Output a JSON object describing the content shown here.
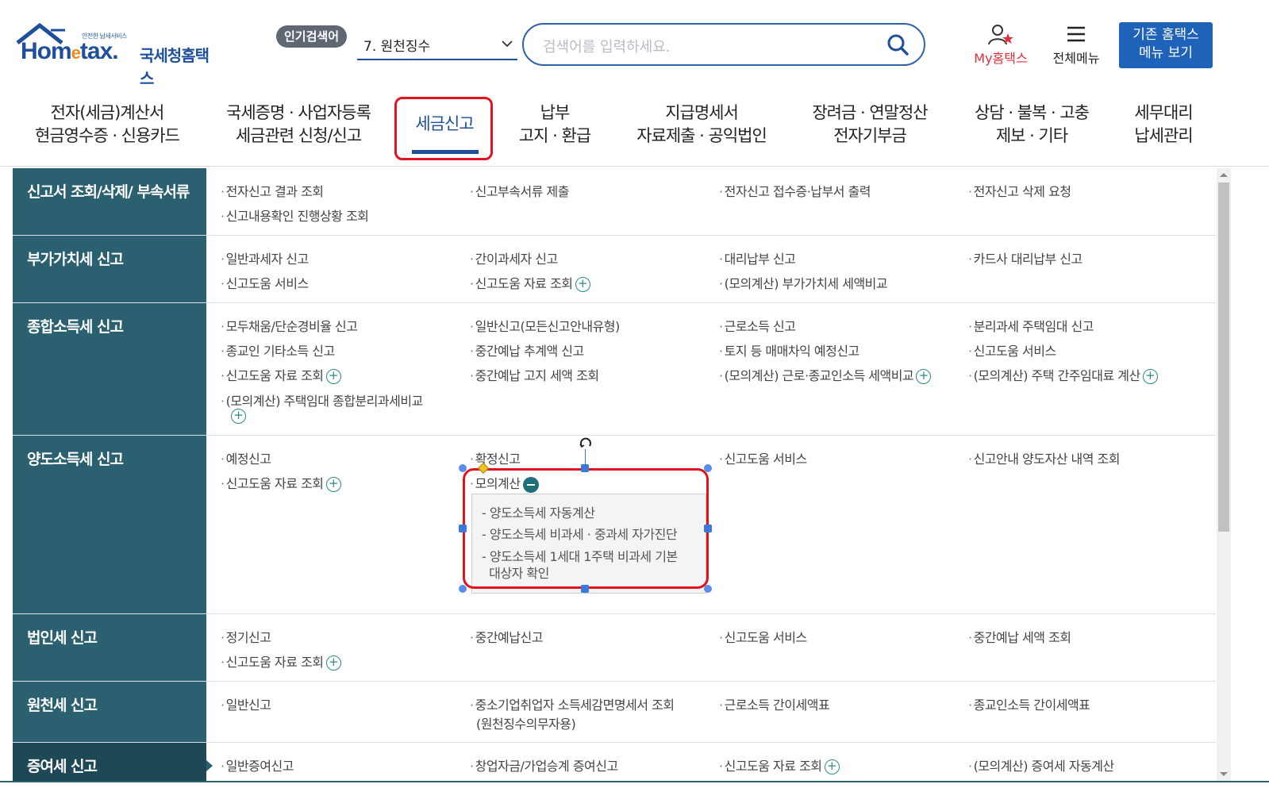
{
  "header": {
    "logo": {
      "sub": "안전한 납세서비스",
      "brand_a": "Hom",
      "brand_e": "e",
      "brand_b": "tax.",
      "kor": "국세청홈택스"
    },
    "popular_badge": "인기검색어",
    "popular_value": "7.  원천징수",
    "search_placeholder": "검색어를 입력하세요.",
    "mytax_label": "My홈택스",
    "allmenu_label": "전체메뉴",
    "old_btn_line1": "기존 홈택스",
    "old_btn_line2": "메뉴 보기"
  },
  "nav": [
    {
      "line1": "전자(세금)계산서",
      "line2": "현금영수증 · 신용카드"
    },
    {
      "line1": "국세증명 · 사업자등록",
      "line2": "세금관련 신청/신고"
    },
    {
      "line1": "세금신고",
      "line2": ""
    },
    {
      "line1": "납부",
      "line2": "고지 · 환급"
    },
    {
      "line1": "지급명세서",
      "line2": "자료제출 · 공익법인"
    },
    {
      "line1": "장려금 · 연말정산",
      "line2": "전자기부금"
    },
    {
      "line1": "상담 · 불복 · 고충",
      "line2": "제보 · 기타"
    },
    {
      "line1": "세무대리",
      "line2": "납세관리"
    }
  ],
  "rows": [
    {
      "cat": "신고서 조회/삭제/ 부속서류",
      "links": [
        "전자신고 결과 조회",
        "신고부속서류 제출",
        "전자신고 접수증·납부서 출력",
        "전자신고 삭제 요청",
        "신고내용확인 진행상황 조회"
      ]
    },
    {
      "cat": "부가가치세 신고",
      "links": [
        "일반과세자 신고",
        "간이과세자 신고",
        "대리납부 신고",
        "카드사 대리납부 신고",
        "신고도움 서비스",
        "신고도움 자료 조회",
        "(모의계산) 부가가치세 세액비교"
      ]
    },
    {
      "cat": "종합소득세 신고",
      "links": [
        "모두채움/단순경비율 신고",
        "일반신고(모든신고안내유형)",
        "근로소득 신고",
        "분리과세 주택임대 신고",
        "종교인 기타소득 신고",
        "중간예납 추계액 신고",
        "토지 등 매매차익 예정신고",
        "신고도움 서비스",
        "신고도움 자료 조회",
        "중간예납 고지 세액 조회",
        "(모의계산) 근로·종교인소득 세액비교",
        "(모의계산) 주택 간주임대료 계산",
        "(모의계산) 주택임대 종합분리과세비교"
      ]
    },
    {
      "cat": "양도소득세 신고",
      "links": [
        "예정신고",
        "확정신고",
        "신고도움 서비스",
        "신고안내 양도자산 내역 조회",
        "신고도움 자료 조회",
        "모의계산"
      ],
      "sub": [
        "양도소득세 자동계산",
        "양도소득세 비과세 · 중과세 자가진단",
        "양도소득세 1세대 1주택 비과세 기본",
        "대상자 확인"
      ]
    },
    {
      "cat": "법인세 신고",
      "links": [
        "정기신고",
        "중간예납신고",
        "신고도움 서비스",
        "중간예납 세액 조회",
        "신고도움 자료 조회"
      ]
    },
    {
      "cat": "원천세 신고",
      "links": [
        "일반신고",
        "중소기업취업자 소득세감면명세서 조회",
        "(원천징수의무자용)",
        "근로소득 간이세액표",
        "종교인소득 간이세액표"
      ]
    },
    {
      "cat": "증여세 신고",
      "links": [
        "일반증여신고",
        "창업자금/가업승계 증여신고",
        "신고도움 자료 조회",
        "(모의계산) 증여세 자동계산"
      ]
    }
  ],
  "colors": {
    "accent": "#1f4f9a",
    "category_bg": "#2a6070",
    "highlight": "#e0141f"
  }
}
